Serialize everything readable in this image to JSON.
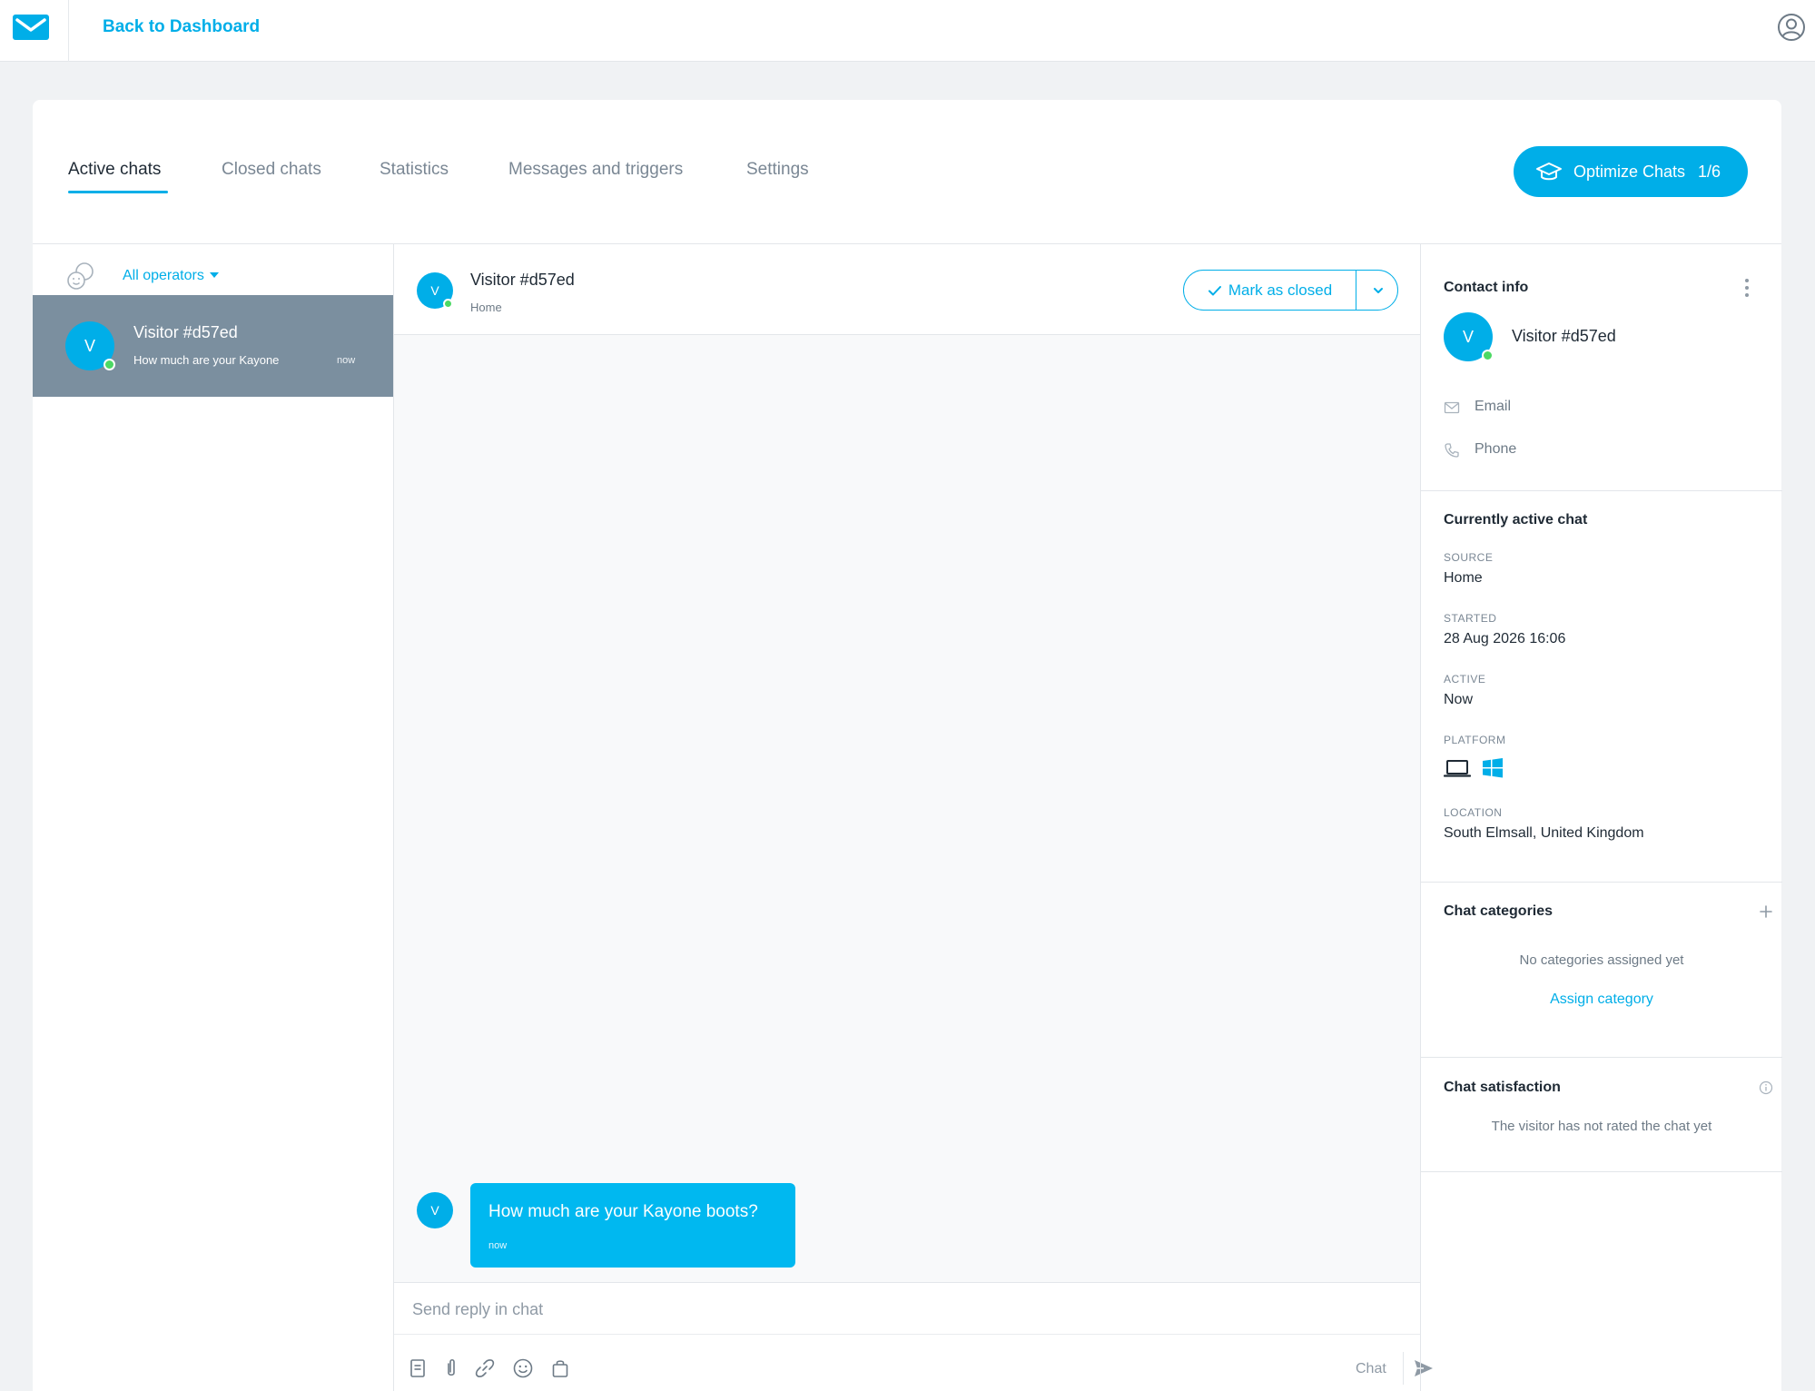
{
  "topbar": {
    "logo": "getresponse-envelope-logo",
    "back_label": "Back to Dashboard",
    "account_icon": "user-circle-icon"
  },
  "tabs": [
    {
      "label": "Active chats",
      "active": true
    },
    {
      "label": "Closed chats",
      "active": false
    },
    {
      "label": "Statistics",
      "active": false
    },
    {
      "label": "Messages and triggers",
      "active": false
    },
    {
      "label": "Settings",
      "active": false
    }
  ],
  "optimize": {
    "label": "Optimize Chats",
    "count": "1/6",
    "icon": "graduation-cap-icon"
  },
  "operators": {
    "selected": "All operators",
    "icon": "operators-icon"
  },
  "chat_list": [
    {
      "avatar_letter": "V",
      "name": "Visitor #d57ed",
      "preview": "How much are your Kayone",
      "time": "now",
      "online": true,
      "selected": true
    }
  ],
  "conversation": {
    "avatar_letter": "V",
    "visitor_name": "Visitor #d57ed",
    "source": "Home",
    "mark_closed_label": "Mark as closed",
    "messages": [
      {
        "from": "visitor",
        "avatar_letter": "V",
        "text": "How much are your Kayone boots?",
        "time": "now"
      }
    ],
    "reply_placeholder": "Send reply in chat",
    "reply_mode": "Chat",
    "tools": [
      "template-icon",
      "attachment-icon",
      "link-icon",
      "emoji-icon",
      "product-bag-icon"
    ]
  },
  "contact_info": {
    "title": "Contact info",
    "avatar_letter": "V",
    "name": "Visitor #d57ed",
    "email_label": "Email",
    "phone_label": "Phone"
  },
  "active_chat": {
    "title": "Currently active chat",
    "source_label": "SOURCE",
    "source_value": "Home",
    "started_label": "STARTED",
    "started_value": "28 Aug 2026 16:06",
    "active_label": "ACTIVE",
    "active_value": "Now",
    "platform_label": "PLATFORM",
    "platform_icons": [
      "laptop-icon",
      "windows-icon"
    ],
    "location_label": "LOCATION",
    "location_value": "South Elmsall, United Kingdom"
  },
  "categories": {
    "title": "Chat categories",
    "empty_text": "No categories assigned yet",
    "assign_label": "Assign category"
  },
  "satisfaction": {
    "title": "Chat satisfaction",
    "text": "The visitor has not rated the chat yet"
  },
  "colors": {
    "accent": "#00aee8",
    "selected_row": "#7b8f9f",
    "online": "#4cd964",
    "bubble": "#00b8f0"
  }
}
